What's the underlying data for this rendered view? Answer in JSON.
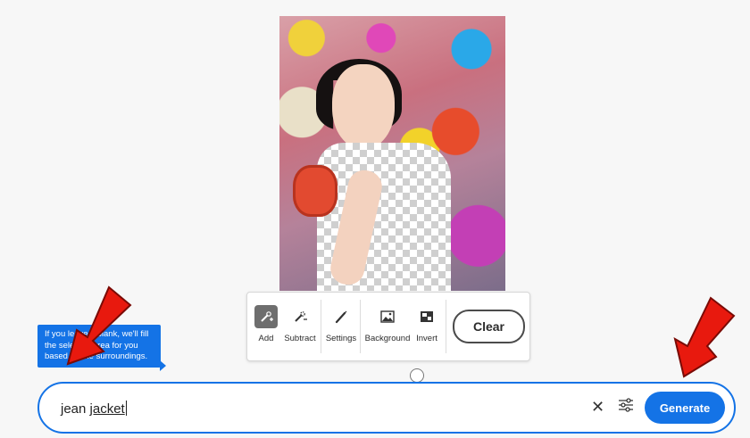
{
  "toolbar": {
    "tools": [
      {
        "label": "Add",
        "icon": "brush-add-icon",
        "active": true
      },
      {
        "label": "Subtract",
        "icon": "brush-subtract-icon",
        "active": false
      },
      {
        "label": "Settings",
        "icon": "brush-settings-icon",
        "active": false
      },
      {
        "label": "Background",
        "icon": "image-background-icon",
        "active": false
      },
      {
        "label": "Invert",
        "icon": "invert-icon",
        "active": false
      }
    ],
    "clear_label": "Clear"
  },
  "tooltip": {
    "text": "If you leave it blank, we'll fill the selected area for you based on the surroundings."
  },
  "prompt": {
    "value_word1": "jean",
    "value_word2": "jacket",
    "clear_icon": "close-icon",
    "settings_icon": "sliders-icon",
    "generate_label": "Generate"
  },
  "colors": {
    "accent": "#1473e6",
    "annotation_arrow": "#e8190e"
  }
}
